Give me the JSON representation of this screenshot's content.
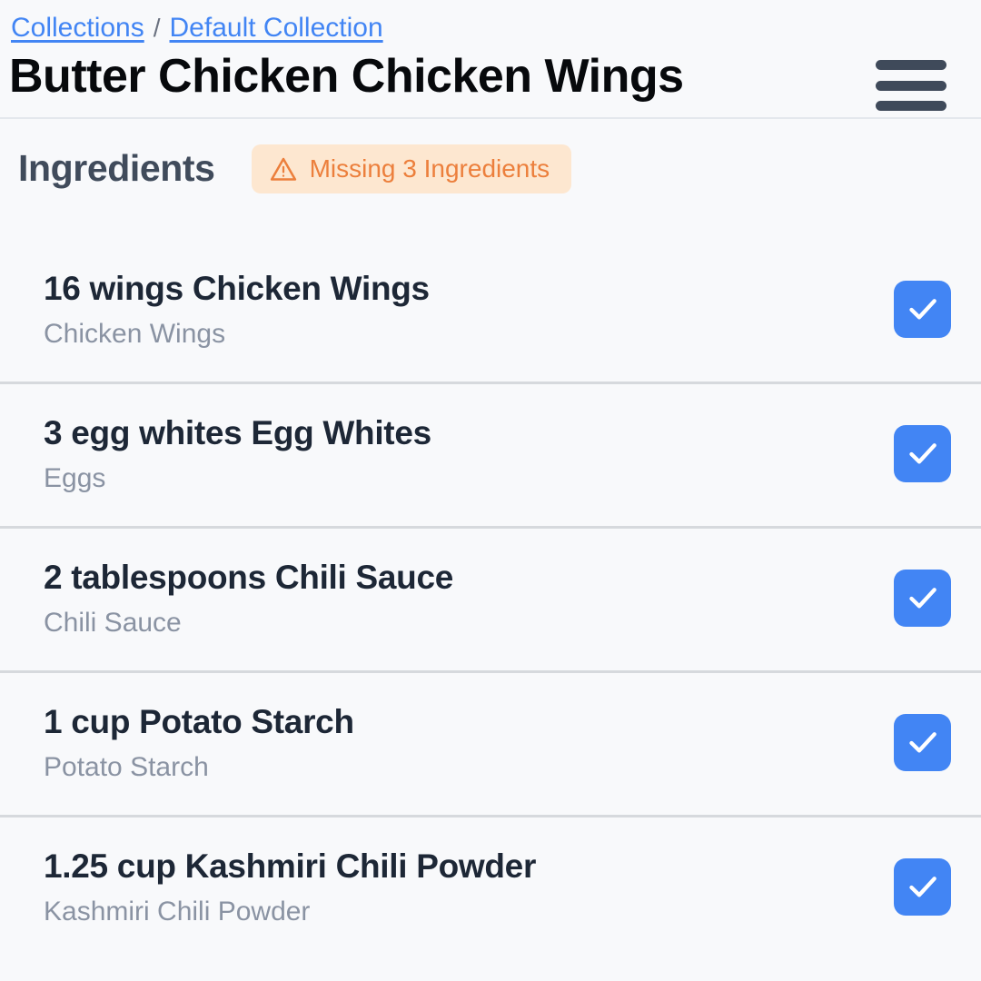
{
  "colors": {
    "background": "#f8f9fb",
    "link": "#4285f4",
    "title": "#07090c",
    "section_title": "#404b5b",
    "badge_bg": "#fde7d0",
    "badge_text": "#ec7f3c",
    "checkbox": "#4285f4",
    "row_title": "#1d2736",
    "row_sub": "#8a93a3",
    "divider": "#d6d9dd",
    "hamburger": "#3f4a5a"
  },
  "header": {
    "breadcrumb": {
      "items": [
        {
          "label": "Collections"
        },
        {
          "label": "Default Collection"
        }
      ],
      "separator": "/"
    },
    "title": "Butter Chicken Chicken Wings",
    "menu_icon": "hamburger-menu-icon"
  },
  "section": {
    "title": "Ingredients",
    "badge": {
      "icon": "warning-triangle-icon",
      "text": "Missing 3 Ingredients"
    }
  },
  "ingredients": [
    {
      "title": "16 wings Chicken Wings",
      "subtitle": "Chicken Wings",
      "checked": true,
      "check_icon": "checkmark-icon"
    },
    {
      "title": "3 egg whites Egg Whites",
      "subtitle": "Eggs",
      "checked": true,
      "check_icon": "checkmark-icon"
    },
    {
      "title": "2 tablespoons Chili Sauce",
      "subtitle": "Chili Sauce",
      "checked": true,
      "check_icon": "checkmark-icon"
    },
    {
      "title": "1 cup Potato Starch",
      "subtitle": "Potato Starch",
      "checked": true,
      "check_icon": "checkmark-icon"
    },
    {
      "title": "1.25 cup Kashmiri Chili Powder",
      "subtitle": "Kashmiri Chili Powder",
      "checked": true,
      "check_icon": "checkmark-icon"
    }
  ]
}
